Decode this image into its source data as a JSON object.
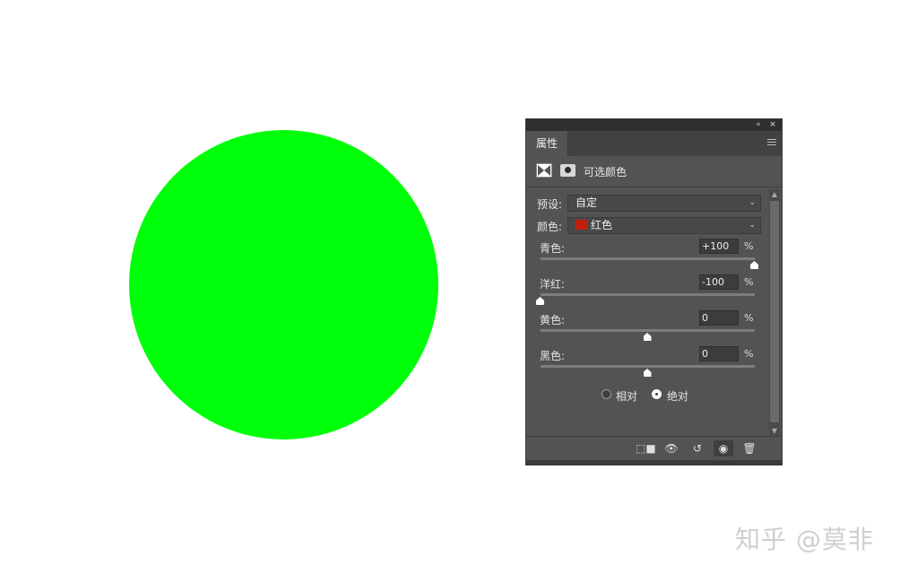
{
  "canvas": {
    "circle_color": "#00ff0a",
    "watermark": "知乎 @莫非"
  },
  "panel": {
    "tab_label": "属性",
    "title": "可选颜色",
    "preset_label": "预设:",
    "preset_value": "自定",
    "colors_label": "颜色:",
    "colors_value": "红色",
    "colors_swatch": "#c0200d",
    "sliders": [
      {
        "label": "青色:",
        "value": "+100",
        "unit": "%",
        "level": 1.0
      },
      {
        "label": "洋红:",
        "value": "-100",
        "unit": "%",
        "level": 0.0
      },
      {
        "label": "黄色:",
        "value": "0",
        "unit": "%",
        "level": 0.5
      },
      {
        "label": "黑色:",
        "value": "0",
        "unit": "%",
        "level": 0.5
      }
    ],
    "method": {
      "relative_label": "相对",
      "absolute_label": "绝对",
      "selected": "absolute"
    },
    "icons": {
      "collapse": "«",
      "close": "×",
      "chevron": "⌄",
      "scroll_up": "▲",
      "scroll_down": "▼",
      "clip": "⬚■",
      "view_prev": "👁",
      "reset": "↺",
      "visibility": "◉",
      "delete": "🗑"
    }
  }
}
